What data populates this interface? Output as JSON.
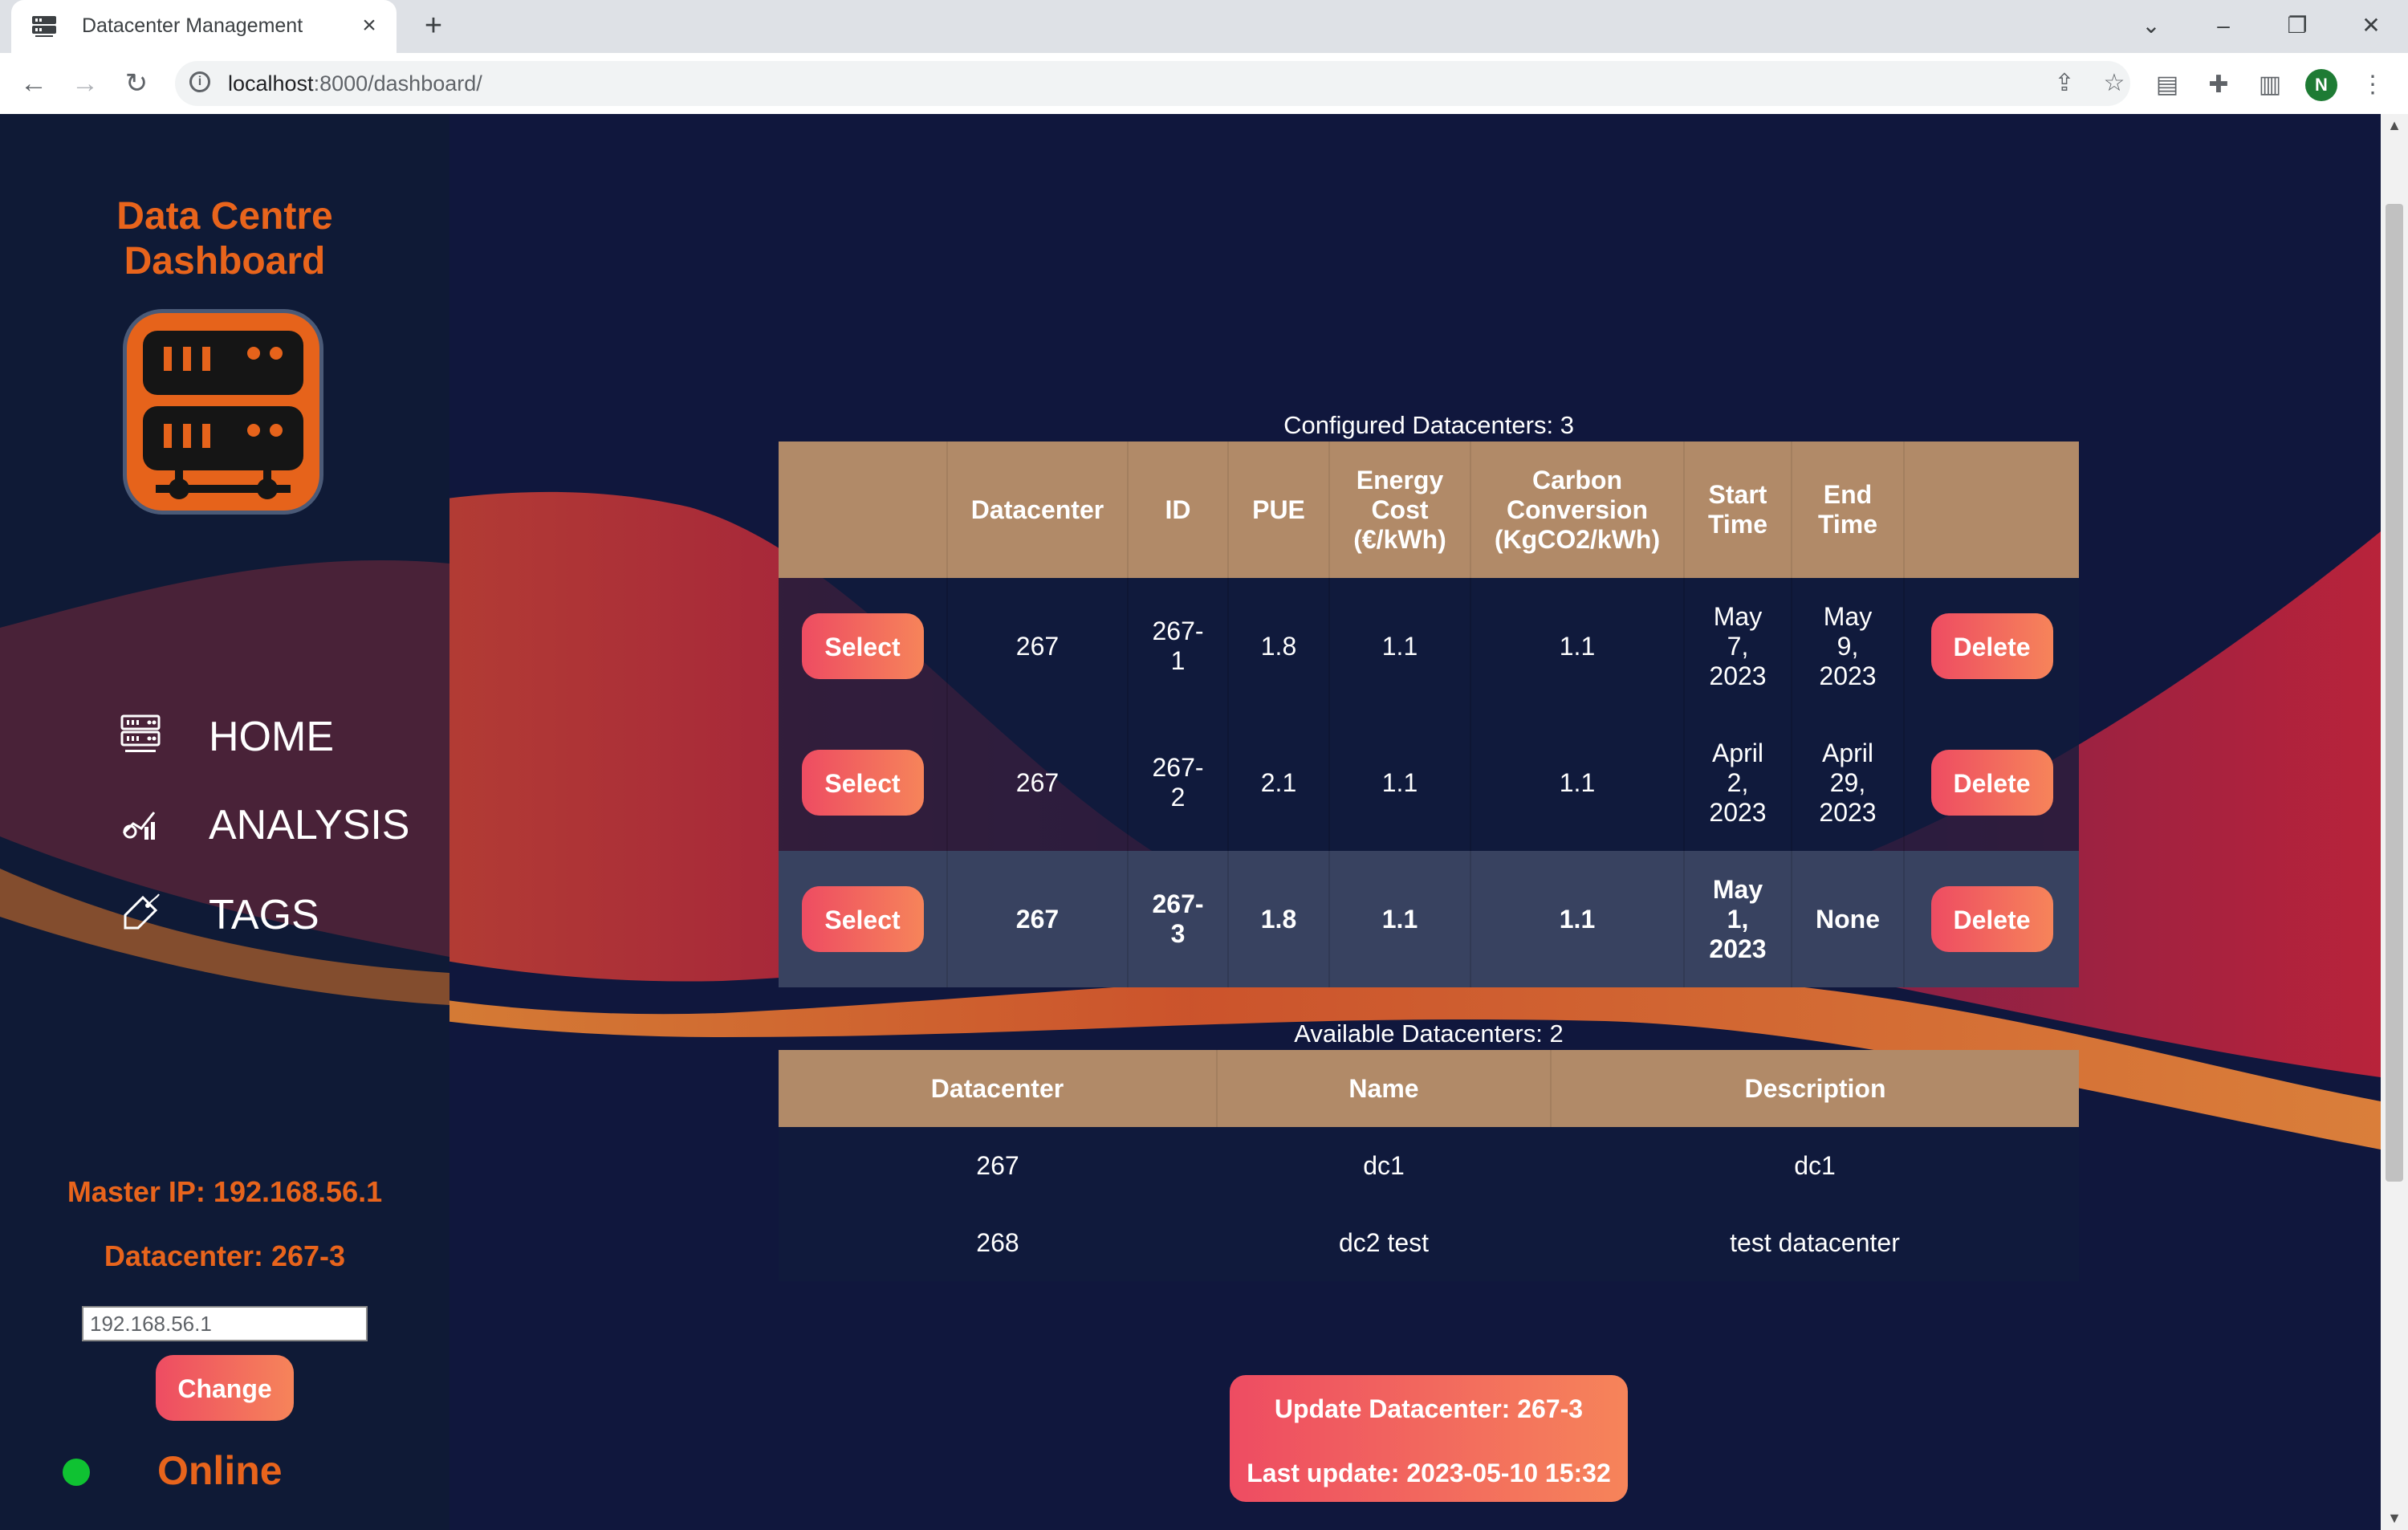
{
  "browser": {
    "tab_title": "Datacenter Management",
    "url_host": "localhost",
    "url_path": ":8000/dashboard/",
    "profile_initial": "N"
  },
  "sidebar": {
    "brand_title": "Data Centre Dashboard",
    "nav": [
      {
        "label": "HOME",
        "icon": "server-rack-icon"
      },
      {
        "label": "ANALYSIS",
        "icon": "chart-analysis-icon"
      },
      {
        "label": "TAGS",
        "icon": "tag-icon"
      }
    ],
    "master_ip_text": "Master IP: 192.168.56.1",
    "datacenter_text": "Datacenter: 267-3",
    "ip_input_value": "192.168.56.1",
    "change_label": "Change",
    "status_label": "Online",
    "status_color": "#0fc232"
  },
  "configured": {
    "caption": "Configured Datacenters: 3",
    "headers": [
      "",
      "Datacenter",
      "ID",
      "PUE",
      "Energy Cost (€/kWh)",
      "Carbon Conversion (KgCO2/kWh)",
      "Start Time",
      "End Time",
      ""
    ],
    "rows": [
      {
        "select": "Select",
        "datacenter": "267",
        "id": "267-1",
        "pue": "1.8",
        "energy": "1.1",
        "carbon": "1.1",
        "start": "May 7, 2023",
        "end": "May 9, 2023",
        "delete": "Delete"
      },
      {
        "select": "Select",
        "datacenter": "267",
        "id": "267-2",
        "pue": "2.1",
        "energy": "1.1",
        "carbon": "1.1",
        "start": "April 2, 2023",
        "end": "April 29, 2023",
        "delete": "Delete"
      },
      {
        "select": "Select",
        "datacenter": "267",
        "id": "267-3",
        "pue": "1.8",
        "energy": "1.1",
        "carbon": "1.1",
        "start": "May 1, 2023",
        "end": "None",
        "delete": "Delete"
      }
    ]
  },
  "available": {
    "caption": "Available Datacenters: 2",
    "headers": [
      "Datacenter",
      "Name",
      "Description"
    ],
    "rows": [
      {
        "datacenter": "267",
        "name": "dc1",
        "description": "dc1"
      },
      {
        "datacenter": "268",
        "name": "dc2 test",
        "description": "test datacenter"
      }
    ]
  },
  "update": {
    "title": "Update Datacenter: 267-3",
    "last_update": "Last update: 2023-05-10 15:32"
  },
  "colors": {
    "accent_orange": "#e8641c",
    "header_tan": "#b18a68",
    "button_gradient_start": "#ee4c62",
    "button_gradient_end": "#f6845a",
    "page_background": "#10173d"
  }
}
